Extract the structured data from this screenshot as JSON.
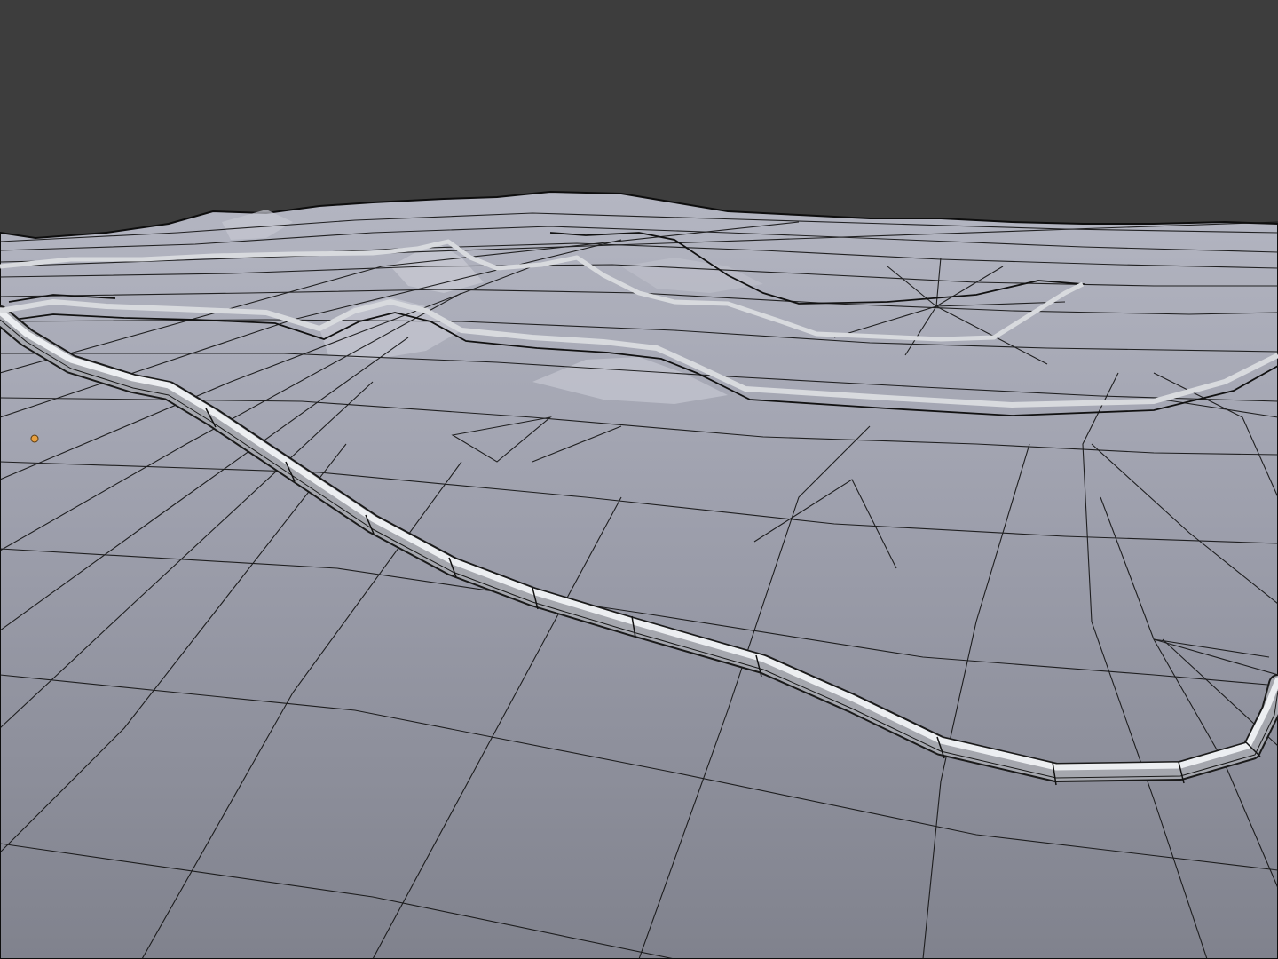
{
  "viewport": {
    "background_color": "#3d3d3d",
    "mesh_color_light": "#a9abb8",
    "mesh_color_dark": "#7c7e8a",
    "wire_color": "#111111",
    "origin_dot_color": "#e8a040",
    "tube_color_light": "#e2e3e6",
    "tube_color_dark": "#8d8f96"
  }
}
